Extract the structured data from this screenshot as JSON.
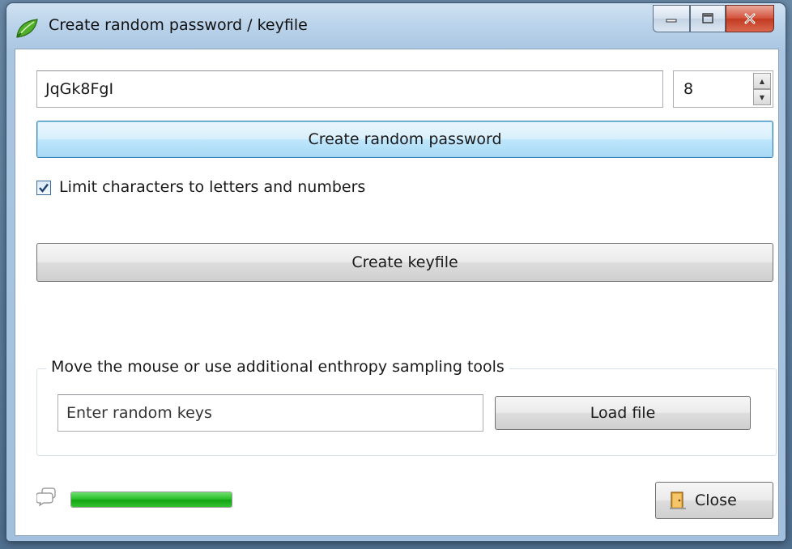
{
  "window": {
    "title": "Create random password / keyfile"
  },
  "password": {
    "value": "JqGk8FgI",
    "length": "8"
  },
  "buttons": {
    "create_password": "Create random password",
    "create_keyfile": "Create keyfile",
    "load_file": "Load file",
    "close": "Close"
  },
  "options": {
    "limit_chars_label": "Limit characters to letters and numbers",
    "limit_chars_checked": true
  },
  "entropy": {
    "group_title": "Move the mouse or use additional enthropy sampling tools",
    "keys_placeholder": "Enter random keys"
  },
  "status": {
    "progress_fraction": 1.0,
    "progress_color": "#2cc12c"
  },
  "icons": {
    "app": "green-leaf-icon",
    "status": "speech-bubble-icon",
    "close": "door-exit-icon"
  }
}
